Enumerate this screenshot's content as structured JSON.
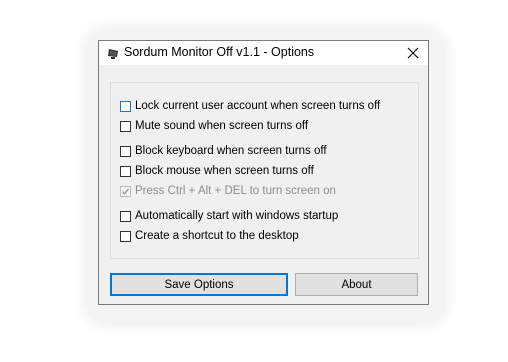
{
  "window": {
    "title": "Sordum Monitor Off v1.1 - Options",
    "close_icon": "close-icon",
    "app_icon": "monitor-off-app-icon"
  },
  "options": [
    {
      "label": "Lock current user account when screen turns off",
      "checked": false,
      "enabled": true,
      "focused": true
    },
    {
      "label": "Mute sound when screen turns off",
      "checked": false,
      "enabled": true,
      "focused": false
    },
    {
      "label": "Block keyboard when screen turns off",
      "checked": false,
      "enabled": true,
      "focused": false
    },
    {
      "label": "Block mouse when screen turns off",
      "checked": false,
      "enabled": true,
      "focused": false
    },
    {
      "label": "Press Ctrl + Alt + DEL to turn screen on",
      "checked": true,
      "enabled": false,
      "focused": false
    },
    {
      "label": "Automatically start with windows startup",
      "checked": false,
      "enabled": true,
      "focused": false
    },
    {
      "label": "Create a shortcut to the desktop",
      "checked": false,
      "enabled": true,
      "focused": false
    }
  ],
  "buttons": {
    "save_label": "Save Options",
    "about_label": "About"
  },
  "colors": {
    "accent": "#0078d7",
    "window_bg": "#f0f0f0",
    "button_bg": "#e1e1e1",
    "disabled_text": "#8d8d8d"
  }
}
